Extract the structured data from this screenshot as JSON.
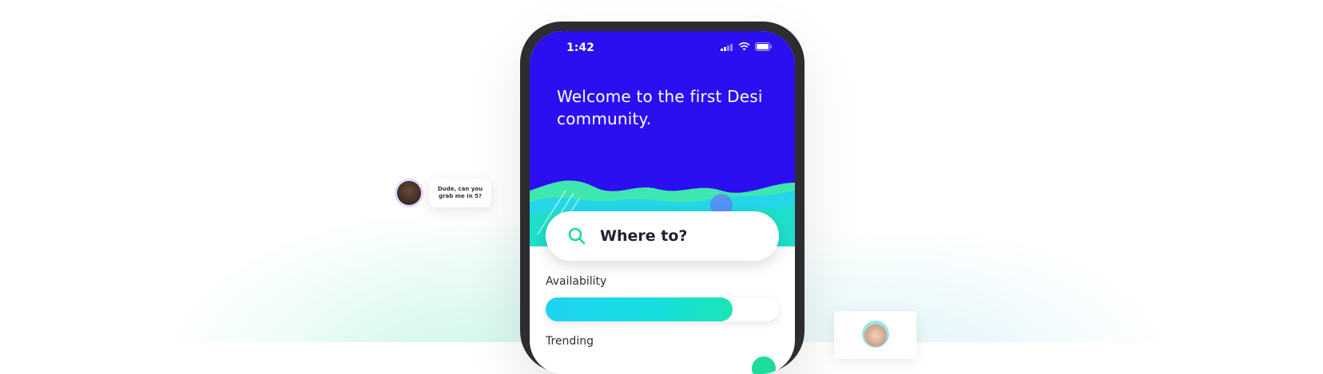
{
  "status_bar": {
    "time": "1:42"
  },
  "welcome": {
    "line1": "Welcome to the first Desi",
    "line2": "community."
  },
  "search": {
    "placeholder": "Where to?",
    "icon": "search-icon"
  },
  "availability": {
    "label": "Availability",
    "level": 0.8
  },
  "trending": {
    "label": "Trending"
  },
  "chat": {
    "line1": "Dude, can you",
    "line2": "grab me in 5?"
  },
  "colors": {
    "header": "#2b0ff0",
    "accent_green": "#1fdc9b",
    "accent_cyan": "#1ed3f2",
    "phone_frame": "#2c2c31"
  }
}
